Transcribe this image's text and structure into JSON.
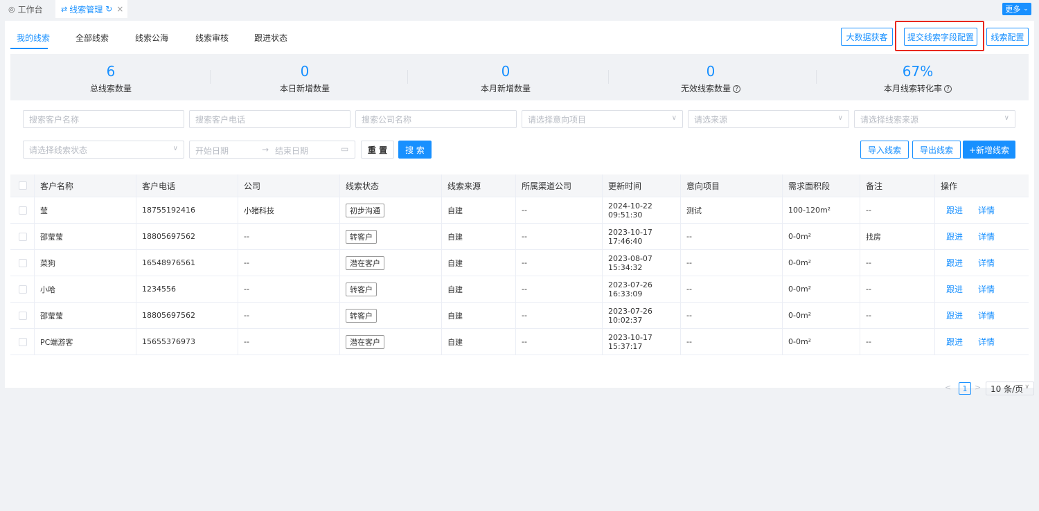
{
  "topbar": {
    "workbench_icon": "dashboard-icon",
    "workbench_label": "工作台",
    "active_tab_icon": "flow-icon",
    "active_tab_label": "线索管理",
    "more_label": "更多"
  },
  "subnav": {
    "tabs": [
      "我的线索",
      "全部线索",
      "线索公海",
      "线索审核",
      "跟进状态"
    ],
    "active_index": 0
  },
  "actions": {
    "big_data": "大数据获客",
    "submit_field_config": "提交线索字段配置",
    "lead_config": "线索配置"
  },
  "stats": [
    {
      "value": "6",
      "label": "总线索数量",
      "help": false
    },
    {
      "value": "0",
      "label": "本日新增数量",
      "help": false
    },
    {
      "value": "0",
      "label": "本月新增数量",
      "help": false
    },
    {
      "value": "0",
      "label": "无效线索数量",
      "help": true
    },
    {
      "value": "67%",
      "label": "本月线索转化率",
      "help": true
    }
  ],
  "filters": {
    "customer_name": "搜索客户名称",
    "customer_phone": "搜索客户电话",
    "company_name": "搜索公司名称",
    "intent_project": "请选择意向项目",
    "source": "请选来源",
    "lead_source": "请选择线索来源",
    "lead_status": "请选择线索状态",
    "start_date": "开始日期",
    "range_sep": "→",
    "end_date": "结束日期",
    "reset": "重 置",
    "search": "搜 索",
    "import": "导入线索",
    "export": "导出线索",
    "add": "+新增线索"
  },
  "table": {
    "headers": [
      "客户名称",
      "客户电话",
      "公司",
      "线索状态",
      "线索来源",
      "所属渠道公司",
      "更新时间",
      "意向项目",
      "需求面积段",
      "备注",
      "操作"
    ],
    "rows": [
      [
        "莹",
        "18755192416",
        "小猪科技",
        "初步沟通",
        "自建",
        "--",
        "2024-10-22 09:51:30",
        "测试",
        "100-120m²",
        "--"
      ],
      [
        "邵莹莹",
        "18805697562",
        "--",
        "转客户",
        "自建",
        "--",
        "2023-10-17 17:46:40",
        "--",
        "0-0m²",
        "找房"
      ],
      [
        "菜狗",
        "16548976561",
        "--",
        "潜在客户",
        "自建",
        "--",
        "2023-08-07 15:34:32",
        "--",
        "0-0m²",
        "--"
      ],
      [
        "小哈",
        "1234556",
        "--",
        "转客户",
        "自建",
        "--",
        "2023-07-26 16:33:09",
        "--",
        "0-0m²",
        "--"
      ],
      [
        "邵莹莹",
        "18805697562",
        "--",
        "转客户",
        "自建",
        "--",
        "2023-07-26 10:02:37",
        "--",
        "0-0m²",
        "--"
      ],
      [
        "PC端游客",
        "15655376973",
        "--",
        "潜在客户",
        "自建",
        "--",
        "2023-10-17 15:37:17",
        "--",
        "0-0m²",
        "--"
      ]
    ],
    "action_follow": "跟进",
    "action_detail": "详情"
  },
  "pagination": {
    "current_page": "1",
    "page_size": "10 条/页"
  }
}
